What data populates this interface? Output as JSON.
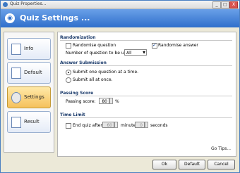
{
  "window": {
    "title": "Quiz Properties...",
    "min_label": "_",
    "max_label": "□",
    "close_label": "X"
  },
  "banner": {
    "title": "Quiz Settings ..."
  },
  "sidebar": {
    "items": [
      {
        "label": "Info",
        "icon": "info-document-icon"
      },
      {
        "label": "Default",
        "icon": "default-document-icon"
      },
      {
        "label": "Settings",
        "icon": "settings-gear-icon",
        "active": true
      },
      {
        "label": "Result",
        "icon": "result-check-icon"
      }
    ]
  },
  "randomization": {
    "heading": "Randomization",
    "randomise_question_label": "Randomise question",
    "randomise_question_checked": false,
    "randomise_answer_label": "Randomise answer",
    "randomise_answer_checked": true,
    "count_label": "Number of question to be used:",
    "count_value": "All"
  },
  "answer_submission": {
    "heading": "Answer Submission",
    "option_one": "Submit one question at a time.",
    "option_all": "Submit all at once.",
    "selected": "one"
  },
  "passing_score": {
    "heading": "Passing Score",
    "label": "Passing score:",
    "value": "80",
    "unit": "%"
  },
  "time_limit": {
    "heading": "Time Limit",
    "end_label": "End quiz after",
    "end_checked": false,
    "minutes_value": "60",
    "minutes_label": "minutes",
    "seconds_value": "0",
    "seconds_label": "seconds"
  },
  "go_tips": "Go Tips...",
  "buttons": {
    "ok": "Ok",
    "default": "Default",
    "cancel": "Cancel"
  }
}
